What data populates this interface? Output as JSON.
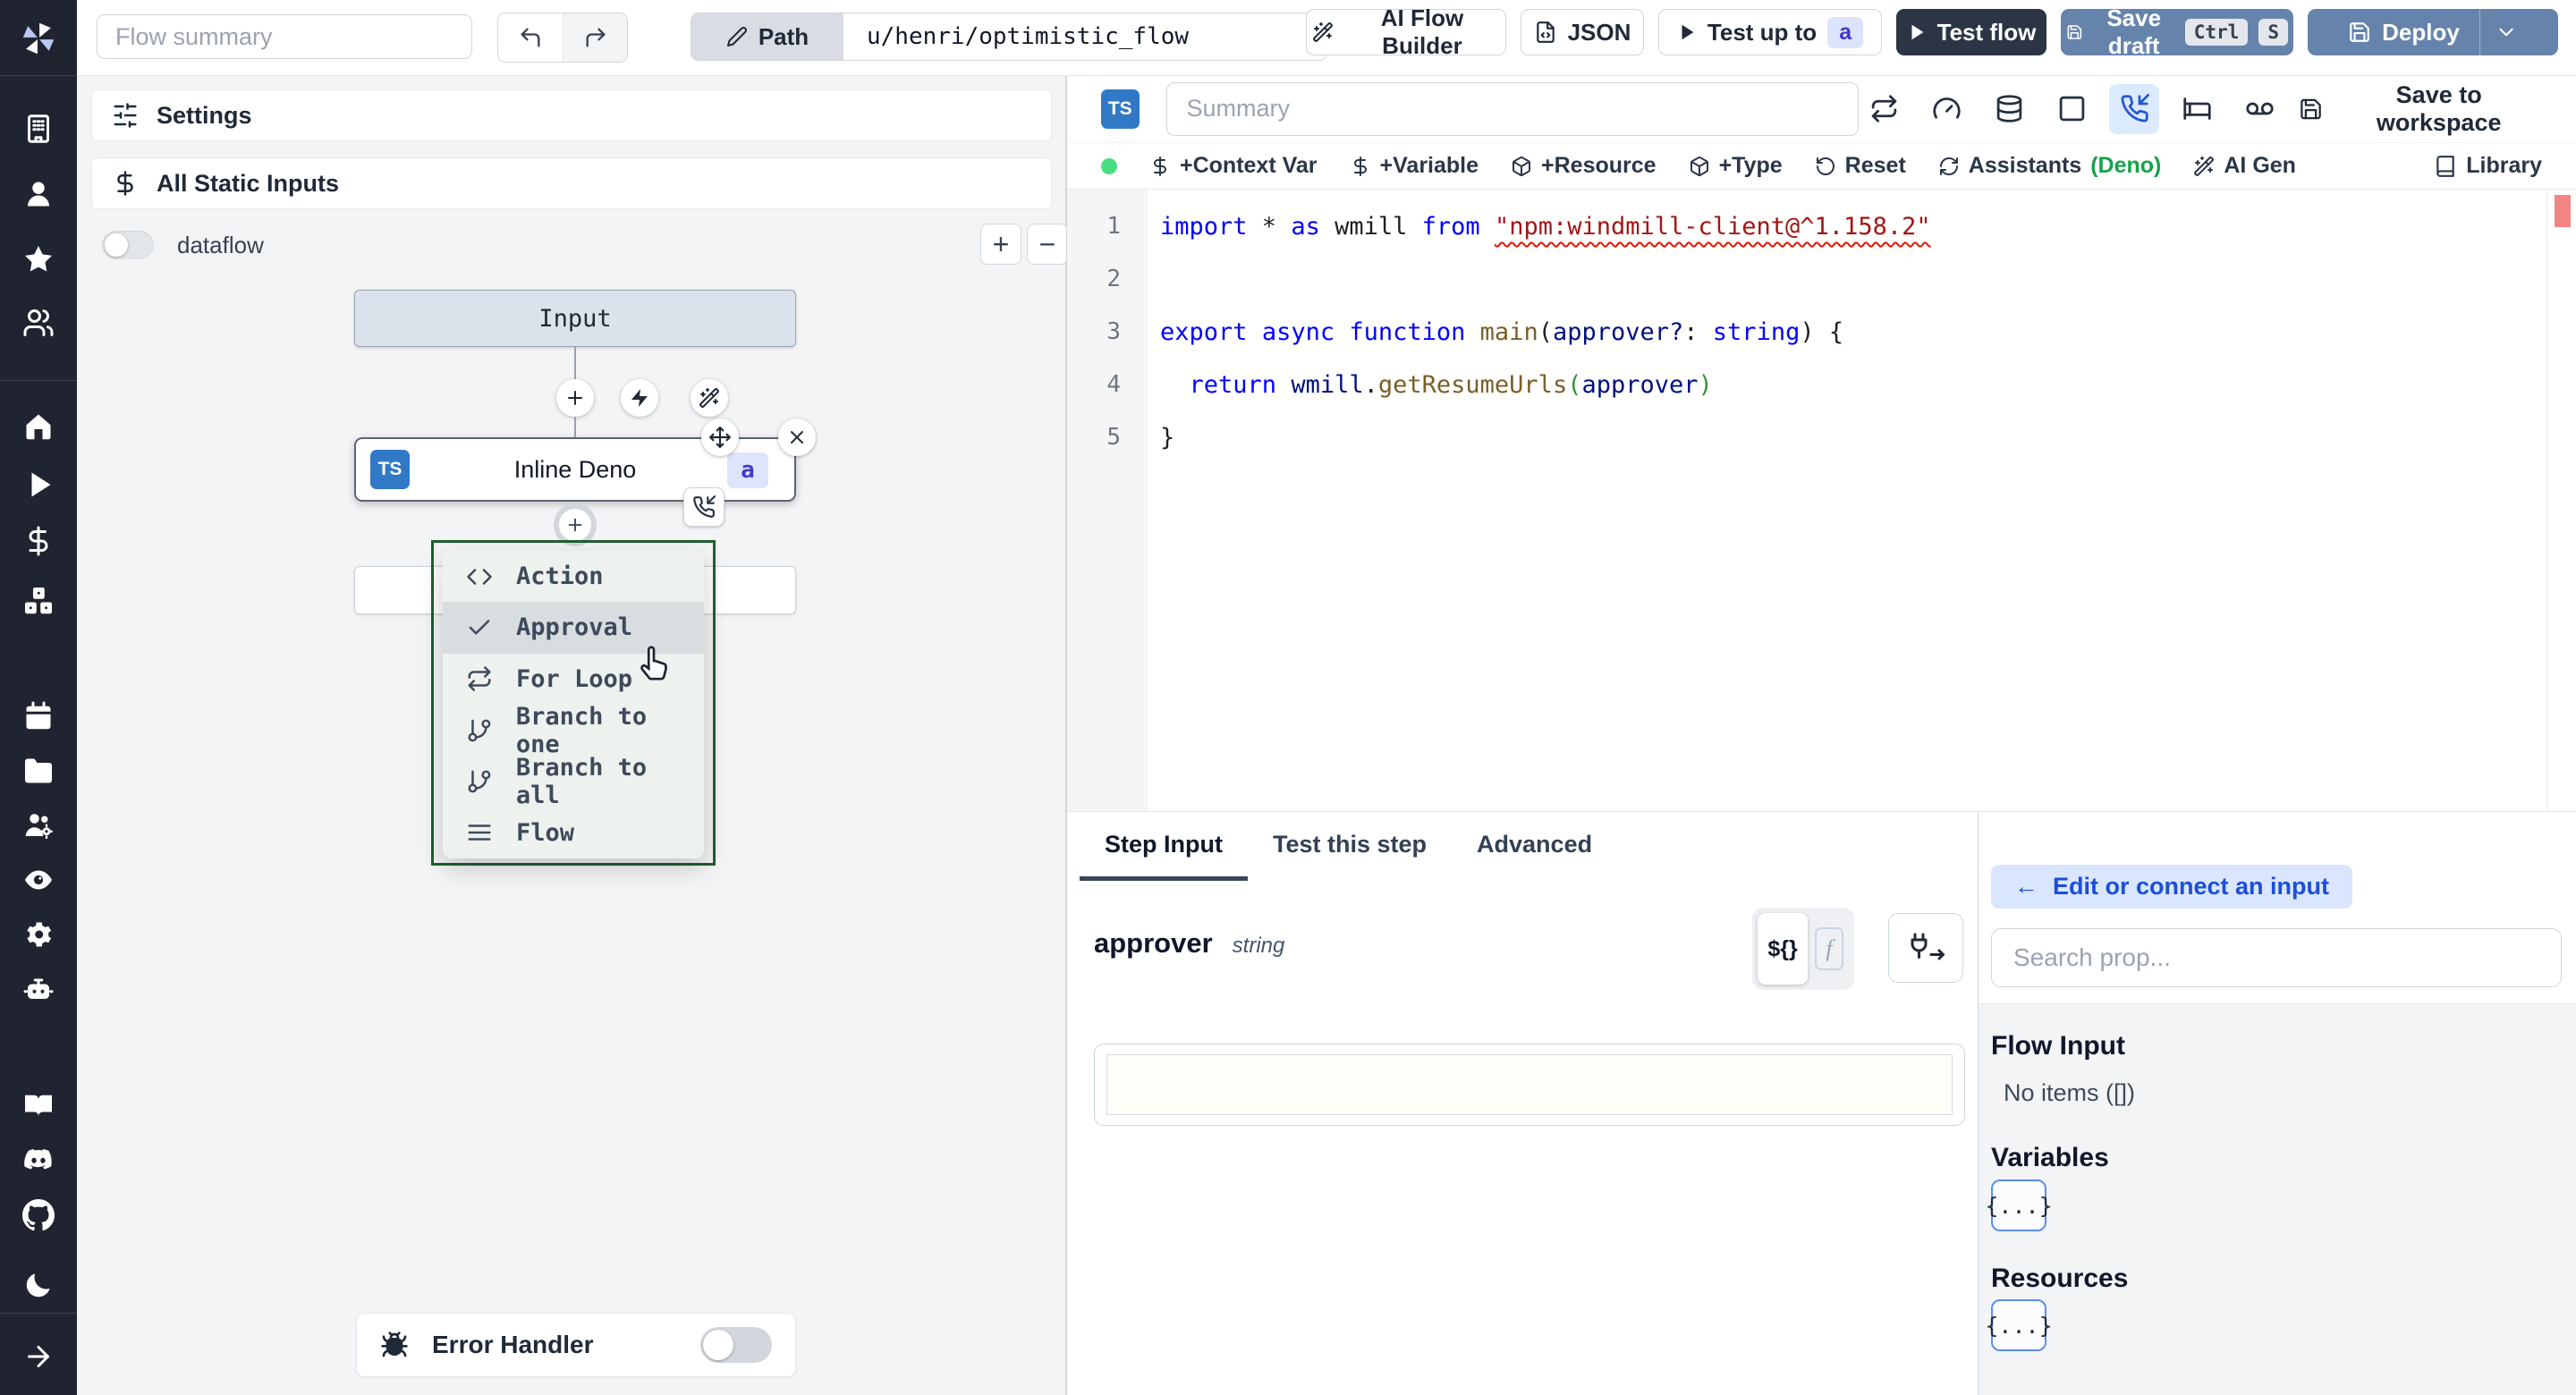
{
  "colors": {
    "topbar_dark": "#2b3544",
    "topbar_slate": "#6684ab",
    "badge_indigo_bg": "#dbe3fd",
    "badge_indigo_text": "#4338ca",
    "menu_border_green": "#1e5f31",
    "status_green": "#4ade80",
    "deno_green": "#16a34a",
    "suspend_active_bg": "#dbeafe",
    "error_red": "#f17070"
  },
  "topbar": {
    "flow_summary_placeholder": "Flow summary",
    "path_label": "Path",
    "path_value": "u/henri/optimistic_flow",
    "ai_flow_builder_label": "AI Flow Builder",
    "json_label": "JSON",
    "test_up_to_label": "Test up to",
    "test_up_to_badge": "a",
    "test_flow_label": "Test flow",
    "save_draft_label": "Save draft",
    "save_draft_kbd": [
      "Ctrl",
      "S"
    ],
    "deploy_label": "Deploy"
  },
  "sidebar": {
    "icons": [
      "windmill-logo",
      "building",
      "user",
      "star",
      "users",
      "home",
      "play",
      "dollar",
      "boxes",
      "calendar",
      "folder",
      "users-cog",
      "eye",
      "gear",
      "bot",
      "book-open",
      "discord",
      "github",
      "moon",
      "arrow-right"
    ]
  },
  "flow_panel": {
    "settings_label": "Settings",
    "static_inputs_label": "All Static Inputs",
    "dataflow_label": "dataflow",
    "zoom_in_label": "+",
    "zoom_out_label": "−",
    "input_node_label": "Input",
    "step_node": {
      "lang": "TS",
      "label": "Inline Deno",
      "badge": "a"
    },
    "insert_menu": {
      "highlighted": "Approval",
      "items": [
        {
          "icon": "code",
          "label": "Action"
        },
        {
          "icon": "check",
          "label": "Approval"
        },
        {
          "icon": "repeat",
          "label": "For Loop"
        },
        {
          "icon": "git-branch",
          "label": "Branch to one"
        },
        {
          "icon": "git-branch",
          "label": "Branch to all"
        },
        {
          "icon": "menu-lines",
          "label": "Flow"
        }
      ]
    },
    "error_handler_label": "Error Handler"
  },
  "editor": {
    "lang_badge": "TS",
    "summary_placeholder": "Summary",
    "save_to_workspace_label": "Save to workspace",
    "icon_buttons": [
      {
        "name": "retries-icon",
        "icon": "repeat",
        "active": false
      },
      {
        "name": "early-stop-icon",
        "icon": "gauge",
        "active": false
      },
      {
        "name": "cache-icon",
        "icon": "database",
        "active": false
      },
      {
        "name": "concurrency-icon",
        "icon": "square",
        "active": false
      },
      {
        "name": "suspend-approval-icon",
        "icon": "phone-incoming",
        "active": true
      },
      {
        "name": "sleep-icon",
        "icon": "bed",
        "active": false
      },
      {
        "name": "mock-icon",
        "icon": "voicemail",
        "active": false
      }
    ],
    "toolbar": {
      "buttons": [
        {
          "name": "add-context-var-button",
          "icon": "dollar",
          "label": "+Context Var"
        },
        {
          "name": "add-variable-button",
          "icon": "dollar",
          "label": "+Variable"
        },
        {
          "name": "add-resource-button",
          "icon": "box",
          "label": "+Resource"
        },
        {
          "name": "add-type-button",
          "icon": "box",
          "label": "+Type"
        },
        {
          "name": "reset-button",
          "icon": "rotate-ccw",
          "label": "Reset"
        },
        {
          "name": "assistants-button",
          "icon": "refresh-cw",
          "label": "Assistants",
          "suffix": "(Deno)"
        },
        {
          "name": "ai-gen-button",
          "icon": "wand-sparkles",
          "label": "AI Gen"
        }
      ],
      "library_label": "Library"
    },
    "code": {
      "lines": [
        {
          "num": "1",
          "tokens": [
            [
              "kw",
              "import"
            ],
            [
              "pl",
              " * "
            ],
            [
              "kw",
              "as"
            ],
            [
              "pl",
              " wmill "
            ],
            [
              "kw",
              "from"
            ],
            [
              "pl",
              " "
            ],
            [
              "str",
              "\"npm:windmill-client@^1.158.2\""
            ]
          ]
        },
        {
          "num": "2",
          "tokens": []
        },
        {
          "num": "3",
          "tokens": [
            [
              "kw",
              "export"
            ],
            [
              "pl",
              " "
            ],
            [
              "kw",
              "async"
            ],
            [
              "pl",
              " "
            ],
            [
              "kw",
              "function"
            ],
            [
              "pl",
              " "
            ],
            [
              "fn",
              "main"
            ],
            [
              "pl",
              "("
            ],
            [
              "id",
              "approver?"
            ],
            [
              "pl",
              ": "
            ],
            [
              "kw",
              "string"
            ],
            [
              "pl",
              ") {"
            ]
          ]
        },
        {
          "num": "4",
          "tokens": [
            [
              "pl",
              "  "
            ],
            [
              "kw",
              "return"
            ],
            [
              "pl",
              " "
            ],
            [
              "id",
              "wmill"
            ],
            [
              "pl",
              "."
            ],
            [
              "fn",
              "getResumeUrls"
            ],
            [
              "grn",
              "("
            ],
            [
              "id",
              "approver"
            ],
            [
              "grn",
              ")"
            ]
          ]
        },
        {
          "num": "5",
          "tokens": [
            [
              "pl",
              "}"
            ]
          ]
        }
      ]
    }
  },
  "step_panel": {
    "tabs": [
      "Step Input",
      "Test this step",
      "Advanced"
    ],
    "active_tab": "Step Input",
    "field": {
      "name": "approver",
      "type": "string"
    },
    "expr_toggle_label": "${}",
    "fn_toggle_label": "f"
  },
  "prop_picker": {
    "back_arrow": "←",
    "edit_connect_label": "Edit or connect an input",
    "search_placeholder": "Search prop...",
    "flow_input_title": "Flow Input",
    "no_items_label": "No items ([])",
    "variables_title": "Variables",
    "variables_chip": "{...}",
    "resources_title": "Resources",
    "resources_chip": "{...}"
  }
}
